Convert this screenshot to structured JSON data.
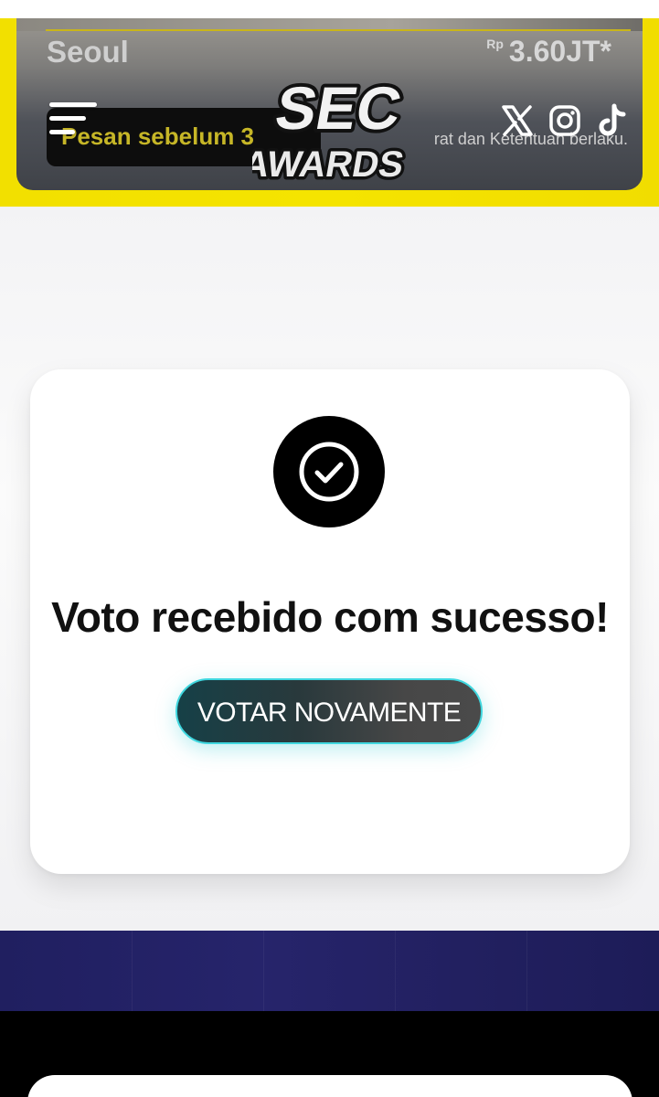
{
  "ad": {
    "city": "Seoul",
    "currency": "Rp",
    "price": "3.60JT*",
    "pill_text": "Pesan sebelum 3",
    "terms": "rat dan Ketentuan berlaku."
  },
  "header": {
    "logo_line1": "SEC",
    "logo_line2": "AWARDS",
    "social": [
      "x-icon",
      "instagram-icon",
      "tiktok-icon"
    ]
  },
  "main": {
    "title": "Voto recebido com sucesso!",
    "button_label": "VOTAR NOVAMENTE"
  },
  "colors": {
    "header_yellow": "#f2e000",
    "button_accent": "#3fd7df",
    "navy": "#222060"
  }
}
